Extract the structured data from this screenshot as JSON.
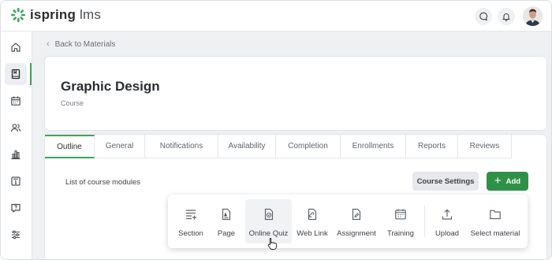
{
  "app": {
    "logo_bold": "ispring",
    "logo_light": " lms",
    "brand_color": "#3aa757"
  },
  "header": {
    "icons": [
      "chat-icon",
      "bell-icon"
    ]
  },
  "sidebar": {
    "items": [
      {
        "name": "home-icon"
      },
      {
        "name": "materials-icon",
        "active": true
      },
      {
        "name": "calendar-icon"
      },
      {
        "name": "users-icon"
      },
      {
        "name": "reports-icon"
      },
      {
        "name": "info-icon"
      },
      {
        "name": "help-icon"
      },
      {
        "name": "settings-icon"
      }
    ]
  },
  "breadcrumb": {
    "back_label": "Back to Materials"
  },
  "course": {
    "title": "Graphic Design",
    "type": "Course"
  },
  "tabs": [
    {
      "label": "Outline",
      "active": true
    },
    {
      "label": "General"
    },
    {
      "label": "Notifications"
    },
    {
      "label": "Availability"
    },
    {
      "label": "Completion"
    },
    {
      "label": "Enrollments"
    },
    {
      "label": "Reports"
    },
    {
      "label": "Reviews"
    }
  ],
  "outline": {
    "list_label": "List of course modules",
    "settings_button": "Course Settings",
    "add_button": "Add"
  },
  "add_menu": {
    "items": [
      {
        "label": "Section",
        "icon": "section-icon"
      },
      {
        "label": "Page",
        "icon": "page-icon"
      },
      {
        "label": "Online Quiz",
        "icon": "quiz-icon",
        "hovered": true
      },
      {
        "label": "Web Link",
        "icon": "web-link-icon"
      },
      {
        "label": "Assignment",
        "icon": "assignment-icon"
      },
      {
        "label": "Training",
        "icon": "training-icon"
      },
      {
        "label": "Upload",
        "icon": "upload-icon"
      },
      {
        "label": "Select material",
        "icon": "folder-icon"
      }
    ]
  }
}
